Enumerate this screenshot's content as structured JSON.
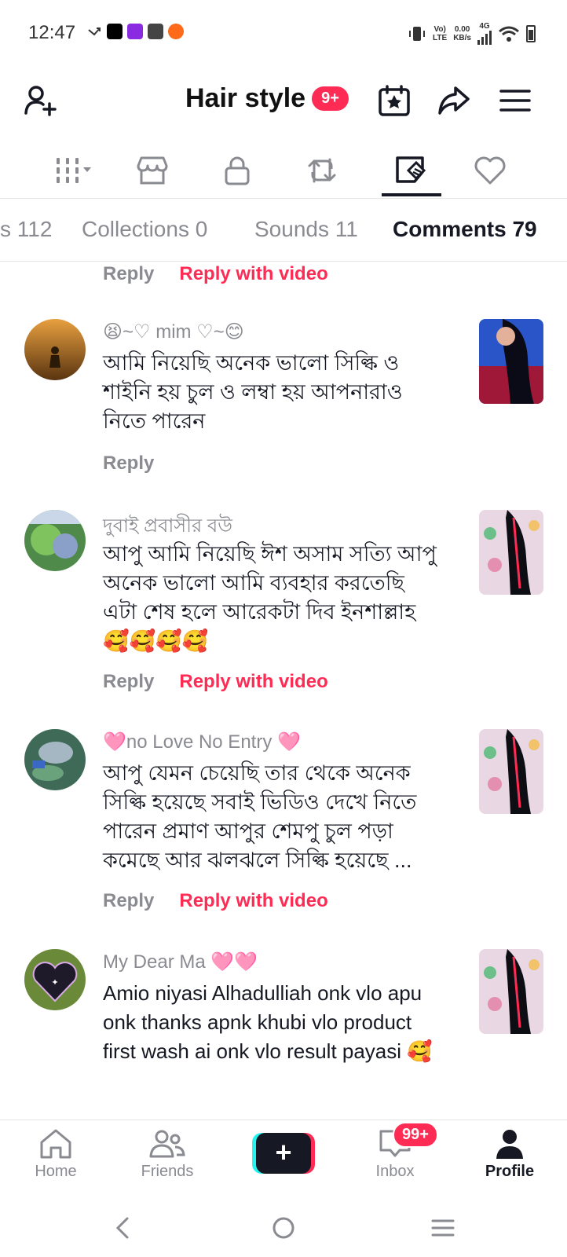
{
  "status_bar": {
    "time": "12:47",
    "net_top": "Vo)",
    "net_bottom": "LTE",
    "speed_top": "0.00",
    "speed_bottom": "KB/s",
    "signal_label": "4G"
  },
  "header": {
    "title": "Hair style",
    "badge": "9+"
  },
  "icon_tabs": [
    "grid-dropdown-icon",
    "shop-icon",
    "lock-icon",
    "repost-icon",
    "comment-video-icon",
    "heart-icon"
  ],
  "text_tabs": [
    {
      "label": "s 112",
      "active": false
    },
    {
      "label": "Collections 0",
      "active": false
    },
    {
      "label": "Sounds 11",
      "active": false
    },
    {
      "label": "Comments 79",
      "active": true
    }
  ],
  "labels": {
    "reply": "Reply",
    "reply_with_video": "Reply with video"
  },
  "comments": [
    {
      "username": "😫~♡ mim ♡~😊",
      "text": "আমি নিয়েছি অনেক ভালো সিল্কি ও শাইনি হয় চুল ও লম্বা হয় আপনারাও নিতে পারেন",
      "has_video_reply": false
    },
    {
      "username": "দুবাই প্রবাসীর বউ",
      "text": "আপু আমি নিয়েছি ঈশ অসাম সত্যি আপু অনেক ভালো আমি ব্যবহার করতেছি এটা শেষ হলে আরেকটা দিব ইনশাল্লাহ🥰🥰🥰🥰",
      "has_video_reply": true
    },
    {
      "username": "🩷no Love  No Entry 🩷",
      "text": "আপু যেমন চেয়েছি তার থেকে অনেক সিল্কি হয়েছে সবাই ভিডিও দেখে নিতে পারেন প্রমাণ আপুর শেমপু চুল পড়া কমেছে আর ঝলঝলে সিল্কি হয়েছে ...",
      "has_video_reply": true
    },
    {
      "username": "My Dear Ma 🩷🩷",
      "text": "Amio niyasi Alhadulliah onk vlo apu onk thanks apnk khubi vlo product first wash ai onk vlo result payasi 🥰",
      "has_video_reply": false
    }
  ],
  "bottom_nav": {
    "home": "Home",
    "friends": "Friends",
    "create": "+",
    "inbox": "Inbox",
    "inbox_badge": "99+",
    "profile": "Profile"
  },
  "colors": {
    "accent": "#fe2c55",
    "teal": "#25f4ee",
    "text": "#161823",
    "muted": "#8a8b91"
  }
}
